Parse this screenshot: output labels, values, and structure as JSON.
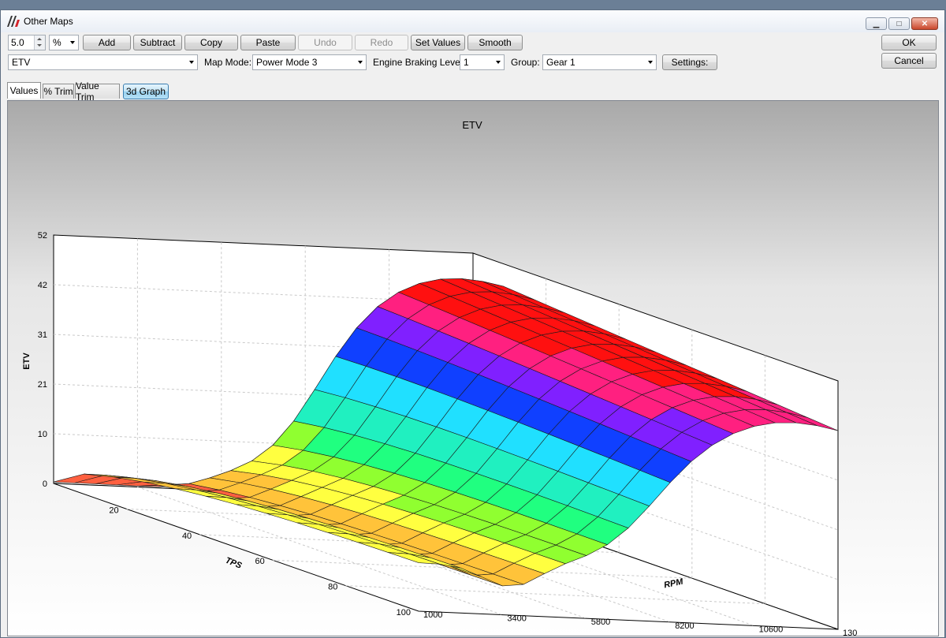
{
  "window": {
    "title": "Other Maps"
  },
  "toolbar": {
    "step_value": "5.0",
    "unit": "%",
    "add_label": "Add",
    "subtract_label": "Subtract",
    "copy_label": "Copy",
    "paste_label": "Paste",
    "undo_label": "Undo",
    "redo_label": "Redo",
    "set_values_label": "Set Values",
    "smooth_label": "Smooth",
    "ok_label": "OK",
    "cancel_label": "Cancel"
  },
  "selectors": {
    "map": "ETV",
    "map_mode_label": "Map Mode:",
    "map_mode": "Power Mode 3",
    "engine_braking_label": "Engine Braking Level:",
    "engine_braking": "1",
    "group_label": "Group:",
    "group": "Gear 1",
    "settings_label": "Settings:"
  },
  "tabs": [
    {
      "label": "Values"
    },
    {
      "label": "% Trim"
    },
    {
      "label": "Value Trim"
    }
  ],
  "graph_toggle_label": "3d Graph",
  "icons": {
    "app": "app-logo-icon",
    "minimize": "minimize-icon",
    "maximize": "maximize-icon",
    "close": "close-icon"
  },
  "chart_data": {
    "type": "surface",
    "title": "ETV",
    "zlabel": "ETV",
    "xlabel": "RPM",
    "ylabel": "TPS",
    "z_ticks": [
      "0",
      "10",
      "21",
      "31",
      "42",
      "52"
    ],
    "x_ticks": [
      "1000",
      "3400",
      "5800",
      "8200",
      "10600",
      "130"
    ],
    "y_ticks": [
      "20",
      "40",
      "60",
      "80",
      "100"
    ],
    "zlim": [
      0,
      52
    ],
    "grid": true
  }
}
